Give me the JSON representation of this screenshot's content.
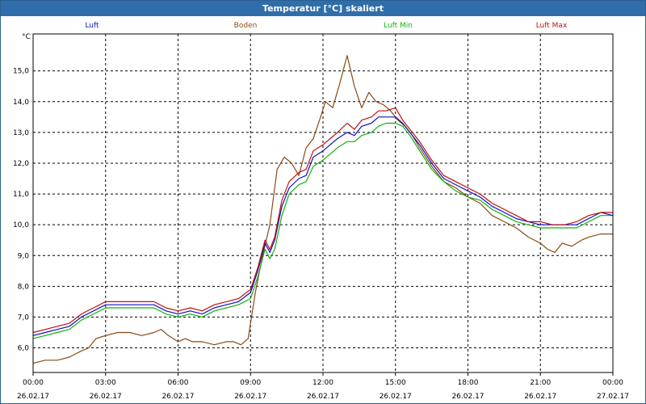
{
  "window": {
    "title": "Temperatur [°C] skaliert"
  },
  "chart_data": {
    "type": "line",
    "title": "Temperatur [°C] skaliert",
    "ylabel": "°C",
    "ylim": [
      5.2,
      16.2
    ],
    "xlim": [
      0,
      24
    ],
    "yticks": [
      6.0,
      7.0,
      8.0,
      9.0,
      10.0,
      11.0,
      12.0,
      13.0,
      14.0,
      15.0
    ],
    "ytick_labels": [
      "6,0",
      "7,0",
      "8,0",
      "9,0",
      "10,0",
      "11,0",
      "12,0",
      "13,0",
      "14,0",
      "15,0"
    ],
    "xticks": [
      {
        "t": 0,
        "time": "00:00",
        "date": "26.02.17"
      },
      {
        "t": 3,
        "time": "03:00",
        "date": "26.02.17"
      },
      {
        "t": 6,
        "time": "06:00",
        "date": "26.02.17"
      },
      {
        "t": 9,
        "time": "09:00",
        "date": "26.02.17"
      },
      {
        "t": 12,
        "time": "12:00",
        "date": "26.02.17"
      },
      {
        "t": 15,
        "time": "15:00",
        "date": "26.02.17"
      },
      {
        "t": 18,
        "time": "18:00",
        "date": "26.02.17"
      },
      {
        "t": 21,
        "time": "21:00",
        "date": "26.02.17"
      },
      {
        "t": 24,
        "time": "00:00",
        "date": "27.02.17"
      }
    ],
    "grid": true,
    "legend_position": "top",
    "series": [
      {
        "name": "Luft",
        "color": "#1010c0",
        "points": [
          [
            0,
            6.4
          ],
          [
            0.5,
            6.5
          ],
          [
            1,
            6.6
          ],
          [
            1.5,
            6.7
          ],
          [
            2,
            7.0
          ],
          [
            2.5,
            7.2
          ],
          [
            3,
            7.4
          ],
          [
            3.5,
            7.4
          ],
          [
            4,
            7.4
          ],
          [
            4.5,
            7.4
          ],
          [
            5,
            7.4
          ],
          [
            5.5,
            7.2
          ],
          [
            6,
            7.1
          ],
          [
            6.5,
            7.2
          ],
          [
            7,
            7.1
          ],
          [
            7.5,
            7.3
          ],
          [
            8,
            7.4
          ],
          [
            8.5,
            7.5
          ],
          [
            9,
            7.8
          ],
          [
            9.3,
            8.5
          ],
          [
            9.6,
            9.4
          ],
          [
            9.8,
            9.1
          ],
          [
            10,
            9.5
          ],
          [
            10.3,
            10.6
          ],
          [
            10.6,
            11.2
          ],
          [
            11,
            11.5
          ],
          [
            11.3,
            11.6
          ],
          [
            11.6,
            12.2
          ],
          [
            12,
            12.4
          ],
          [
            12.3,
            12.6
          ],
          [
            12.6,
            12.8
          ],
          [
            13,
            13.0
          ],
          [
            13.3,
            12.9
          ],
          [
            13.6,
            13.2
          ],
          [
            14,
            13.3
          ],
          [
            14.3,
            13.5
          ],
          [
            14.6,
            13.5
          ],
          [
            15,
            13.5
          ],
          [
            15.3,
            13.3
          ],
          [
            15.6,
            13.0
          ],
          [
            16,
            12.6
          ],
          [
            16.5,
            12.0
          ],
          [
            17,
            11.5
          ],
          [
            17.5,
            11.3
          ],
          [
            18,
            11.1
          ],
          [
            18.5,
            10.9
          ],
          [
            19,
            10.6
          ],
          [
            19.5,
            10.4
          ],
          [
            20,
            10.2
          ],
          [
            20.5,
            10.1
          ],
          [
            21,
            10.0
          ],
          [
            21.5,
            10.0
          ],
          [
            22,
            10.0
          ],
          [
            22.5,
            10.0
          ],
          [
            23,
            10.2
          ],
          [
            23.5,
            10.4
          ],
          [
            24,
            10.3
          ]
        ]
      },
      {
        "name": "Boden",
        "color": "#8b4a14",
        "points": [
          [
            0,
            5.5
          ],
          [
            0.5,
            5.6
          ],
          [
            1,
            5.6
          ],
          [
            1.5,
            5.7
          ],
          [
            2,
            5.9
          ],
          [
            2.3,
            6.0
          ],
          [
            2.6,
            6.3
          ],
          [
            3,
            6.4
          ],
          [
            3.5,
            6.5
          ],
          [
            4,
            6.5
          ],
          [
            4.5,
            6.4
          ],
          [
            5,
            6.5
          ],
          [
            5.3,
            6.6
          ],
          [
            5.6,
            6.4
          ],
          [
            6,
            6.2
          ],
          [
            6.3,
            6.3
          ],
          [
            6.6,
            6.2
          ],
          [
            7,
            6.2
          ],
          [
            7.5,
            6.1
          ],
          [
            8,
            6.2
          ],
          [
            8.3,
            6.2
          ],
          [
            8.6,
            6.1
          ],
          [
            8.9,
            6.3
          ],
          [
            9.2,
            7.8
          ],
          [
            9.5,
            9.0
          ],
          [
            9.8,
            10.0
          ],
          [
            10.1,
            11.8
          ],
          [
            10.4,
            12.2
          ],
          [
            10.7,
            12.0
          ],
          [
            11,
            11.6
          ],
          [
            11.3,
            12.5
          ],
          [
            11.6,
            12.8
          ],
          [
            11.9,
            13.5
          ],
          [
            12.1,
            14.0
          ],
          [
            12.4,
            13.8
          ],
          [
            12.7,
            14.6
          ],
          [
            13,
            15.5
          ],
          [
            13.3,
            14.5
          ],
          [
            13.6,
            13.8
          ],
          [
            13.9,
            14.3
          ],
          [
            14.2,
            14.0
          ],
          [
            14.5,
            13.9
          ],
          [
            14.8,
            13.7
          ],
          [
            15.1,
            13.4
          ],
          [
            15.4,
            13.2
          ],
          [
            15.7,
            12.9
          ],
          [
            16,
            12.5
          ],
          [
            16.5,
            11.9
          ],
          [
            17,
            11.4
          ],
          [
            17.5,
            11.2
          ],
          [
            18,
            10.9
          ],
          [
            18.5,
            10.7
          ],
          [
            19,
            10.3
          ],
          [
            19.5,
            10.1
          ],
          [
            20,
            9.9
          ],
          [
            20.5,
            9.6
          ],
          [
            21,
            9.4
          ],
          [
            21.3,
            9.2
          ],
          [
            21.6,
            9.1
          ],
          [
            21.9,
            9.4
          ],
          [
            22.3,
            9.3
          ],
          [
            22.7,
            9.5
          ],
          [
            23,
            9.6
          ],
          [
            23.5,
            9.7
          ],
          [
            24,
            9.7
          ]
        ]
      },
      {
        "name": "Luft Min",
        "color": "#10b010",
        "points": [
          [
            0,
            6.3
          ],
          [
            0.5,
            6.4
          ],
          [
            1,
            6.5
          ],
          [
            1.5,
            6.6
          ],
          [
            2,
            6.9
          ],
          [
            2.5,
            7.1
          ],
          [
            3,
            7.3
          ],
          [
            3.5,
            7.3
          ],
          [
            4,
            7.3
          ],
          [
            4.5,
            7.3
          ],
          [
            5,
            7.3
          ],
          [
            5.5,
            7.1
          ],
          [
            6,
            7.0
          ],
          [
            6.5,
            7.1
          ],
          [
            7,
            7.0
          ],
          [
            7.5,
            7.2
          ],
          [
            8,
            7.3
          ],
          [
            8.5,
            7.4
          ],
          [
            9,
            7.6
          ],
          [
            9.3,
            8.3
          ],
          [
            9.6,
            9.2
          ],
          [
            9.8,
            8.9
          ],
          [
            10,
            9.2
          ],
          [
            10.3,
            10.3
          ],
          [
            10.6,
            11.0
          ],
          [
            11,
            11.3
          ],
          [
            11.3,
            11.4
          ],
          [
            11.6,
            11.9
          ],
          [
            12,
            12.1
          ],
          [
            12.3,
            12.3
          ],
          [
            12.6,
            12.5
          ],
          [
            13,
            12.7
          ],
          [
            13.3,
            12.7
          ],
          [
            13.6,
            12.9
          ],
          [
            14,
            13.0
          ],
          [
            14.3,
            13.2
          ],
          [
            14.6,
            13.3
          ],
          [
            15,
            13.3
          ],
          [
            15.3,
            13.2
          ],
          [
            15.6,
            12.9
          ],
          [
            16,
            12.4
          ],
          [
            16.5,
            11.8
          ],
          [
            17,
            11.4
          ],
          [
            17.5,
            11.1
          ],
          [
            18,
            10.9
          ],
          [
            18.5,
            10.8
          ],
          [
            19,
            10.5
          ],
          [
            19.5,
            10.3
          ],
          [
            20,
            10.1
          ],
          [
            20.5,
            10.0
          ],
          [
            21,
            9.9
          ],
          [
            21.5,
            9.9
          ],
          [
            22,
            9.9
          ],
          [
            22.5,
            9.9
          ],
          [
            23,
            10.1
          ],
          [
            23.5,
            10.3
          ],
          [
            24,
            10.3
          ]
        ]
      },
      {
        "name": "Luft Max",
        "color": "#c01010",
        "points": [
          [
            0,
            6.5
          ],
          [
            0.5,
            6.6
          ],
          [
            1,
            6.7
          ],
          [
            1.5,
            6.8
          ],
          [
            2,
            7.1
          ],
          [
            2.5,
            7.3
          ],
          [
            3,
            7.5
          ],
          [
            3.5,
            7.5
          ],
          [
            4,
            7.5
          ],
          [
            4.5,
            7.5
          ],
          [
            5,
            7.5
          ],
          [
            5.5,
            7.3
          ],
          [
            6,
            7.2
          ],
          [
            6.5,
            7.3
          ],
          [
            7,
            7.2
          ],
          [
            7.5,
            7.4
          ],
          [
            8,
            7.5
          ],
          [
            8.5,
            7.6
          ],
          [
            9,
            7.9
          ],
          [
            9.3,
            8.6
          ],
          [
            9.6,
            9.5
          ],
          [
            9.8,
            9.2
          ],
          [
            10,
            9.6
          ],
          [
            10.3,
            10.8
          ],
          [
            10.6,
            11.4
          ],
          [
            11,
            11.7
          ],
          [
            11.3,
            11.8
          ],
          [
            11.6,
            12.4
          ],
          [
            12,
            12.6
          ],
          [
            12.3,
            12.8
          ],
          [
            12.6,
            13.0
          ],
          [
            13,
            13.3
          ],
          [
            13.3,
            13.1
          ],
          [
            13.6,
            13.4
          ],
          [
            14,
            13.5
          ],
          [
            14.3,
            13.7
          ],
          [
            14.6,
            13.7
          ],
          [
            15,
            13.8
          ],
          [
            15.3,
            13.4
          ],
          [
            15.6,
            13.1
          ],
          [
            16,
            12.7
          ],
          [
            16.5,
            12.1
          ],
          [
            17,
            11.6
          ],
          [
            17.5,
            11.4
          ],
          [
            18,
            11.2
          ],
          [
            18.5,
            11.0
          ],
          [
            19,
            10.7
          ],
          [
            19.5,
            10.5
          ],
          [
            20,
            10.3
          ],
          [
            20.5,
            10.1
          ],
          [
            21,
            10.1
          ],
          [
            21.5,
            10.0
          ],
          [
            22,
            10.0
          ],
          [
            22.5,
            10.1
          ],
          [
            23,
            10.3
          ],
          [
            23.5,
            10.4
          ],
          [
            24,
            10.4
          ]
        ]
      }
    ]
  }
}
